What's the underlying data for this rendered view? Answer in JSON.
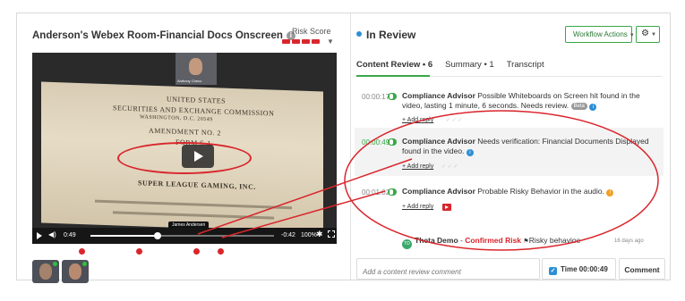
{
  "left": {
    "title": "Anderson's Webex Room-Financial Docs Onscreen",
    "risk_label": "Risk Score",
    "video": {
      "doc_lines": [
        "UNITED STATES",
        "SECURITIES AND EXCHANGE COMMISSION",
        "WASHINGTON, D.C. 20549",
        "AMENDMENT NO. 2",
        "FORM S-1",
        "SUPER LEAGUE GAMING, INC."
      ],
      "cam_name": "Anthony Cheuc",
      "tooltip": "James Andersen",
      "time_elapsed": "0:49",
      "time_remaining": "-0:42",
      "zoom": "100%"
    }
  },
  "right": {
    "status": "In Review",
    "workflow_label": "Workflow Actions",
    "tabs": [
      "Content Review • 6",
      "Summary • 1",
      "Transcript"
    ],
    "items": [
      {
        "ts": "00:00:17",
        "source": "Compliance Advisor",
        "text": "Possible Whiteboards on Screen hit found in the video, lasting 1 minute, 6 seconds. Needs review.",
        "badge": "Beta",
        "reply": "+ Add reply"
      },
      {
        "ts": "00:00:49",
        "source": "Compliance Advisor",
        "text": "Needs verification: Financial Documents Displayed found in the video.",
        "reply": "+ Add reply"
      },
      {
        "ts": "00:01:02",
        "source": "Compliance Advisor",
        "text": "Probable Risky Behavior in the audio.",
        "reply": "+ Add reply"
      }
    ],
    "sub": {
      "avatar": "TD",
      "name": "Theta Demo",
      "sep": " - ",
      "confirmed": "Confirmed Risk",
      "rest": "Risky behavioe",
      "ago": "16 days ago"
    },
    "comment": {
      "placeholder": "Add a content review comment",
      "time": "Time 00:00:49",
      "button": "Comment"
    }
  },
  "colors": {
    "accent_green": "#39a748",
    "risk_red": "#d9262c",
    "info_blue": "#2d8fd6"
  }
}
